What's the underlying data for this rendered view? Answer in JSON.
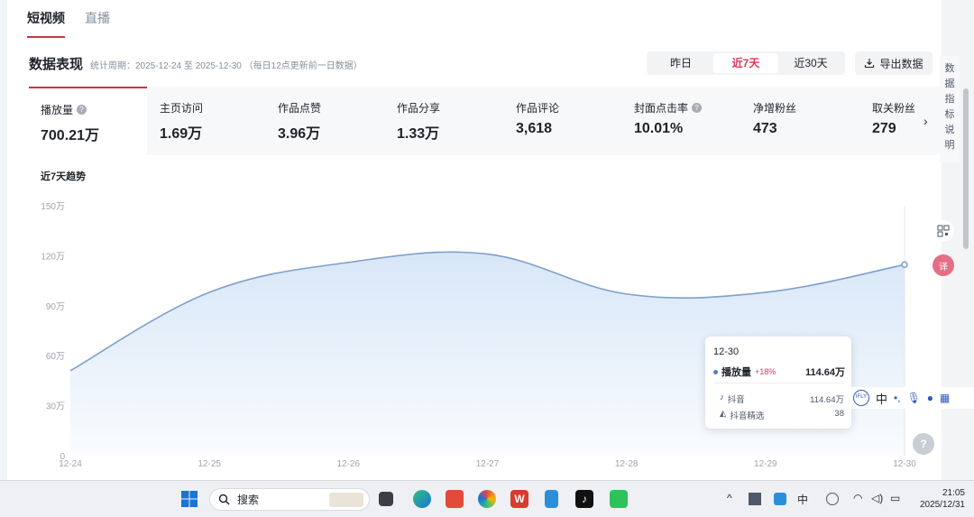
{
  "tabs": [
    {
      "label": "短视频",
      "active": true
    },
    {
      "label": "直播",
      "active": false
    }
  ],
  "section": {
    "title": "数据表现",
    "period": "统计周期：2025-12-24 至 2025-12-30 （每日12点更新前一日数据）"
  },
  "range": {
    "options": [
      "昨日",
      "近7天",
      "近30天"
    ],
    "selected": "近7天"
  },
  "export_label": "导出数据",
  "metrics": [
    {
      "label": "播放量",
      "value": "700.21万",
      "help": true,
      "active": true
    },
    {
      "label": "主页访问",
      "value": "1.69万"
    },
    {
      "label": "作品点赞",
      "value": "3.96万"
    },
    {
      "label": "作品分享",
      "value": "1.33万"
    },
    {
      "label": "作品评论",
      "value": "3,618"
    },
    {
      "label": "封面点击率",
      "value": "10.01%",
      "help": true
    },
    {
      "label": "净增粉丝",
      "value": "473"
    },
    {
      "label": "取关粉丝",
      "value": "279"
    }
  ],
  "trend_title": "近7天趋势",
  "chart_data": {
    "type": "area",
    "x": [
      "12-24",
      "12-25",
      "12-26",
      "12-27",
      "12-28",
      "12-29",
      "12-30"
    ],
    "y_ticks": [
      "0",
      "30万",
      "60万",
      "90万",
      "120万",
      "150万"
    ],
    "ylim": [
      0,
      150
    ],
    "series": [
      {
        "name": "播放量",
        "values": [
          51,
          98,
          116,
          121,
          97,
          98,
          114.64
        ]
      }
    ],
    "line_color": "#7f9fca",
    "fill_color": "#d5e5f7",
    "grid": false
  },
  "tooltip": {
    "date": "12-30",
    "name": "播放量",
    "change": "+18%",
    "value": "114.64万",
    "rows": [
      {
        "label": "抖音",
        "value": "114.64万"
      },
      {
        "label": "抖音精选",
        "value": "38"
      }
    ]
  },
  "side_panel": {
    "label": "数据指标说明"
  },
  "ime": {
    "lang": "中"
  },
  "taskbar": {
    "search_label": "搜索",
    "clock_time": "21:05",
    "clock_date": "2025/12/31",
    "tray_ime": "中"
  }
}
